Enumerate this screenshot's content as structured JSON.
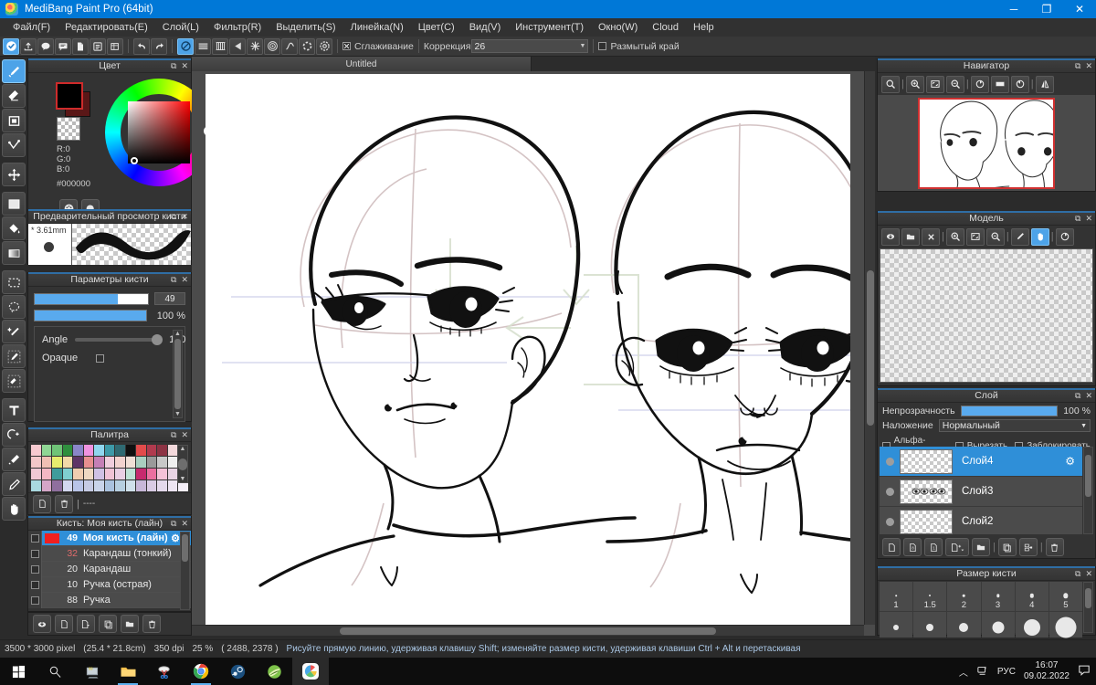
{
  "window": {
    "title": "MediBang Paint Pro (64bit)",
    "minimize": "─",
    "maximize": "❐",
    "close": "✕"
  },
  "menu": {
    "items": [
      {
        "label": "Файл(F)"
      },
      {
        "label": "Редактировать(E)"
      },
      {
        "label": "Слой(L)"
      },
      {
        "label": "Фильтр(R)"
      },
      {
        "label": "Выделить(S)"
      },
      {
        "label": "Линейка(N)"
      },
      {
        "label": "Цвет(C)"
      },
      {
        "label": "Вид(V)"
      },
      {
        "label": "Инструмент(T)"
      },
      {
        "label": "Окно(W)"
      },
      {
        "label": "Cloud"
      },
      {
        "label": "Help"
      }
    ]
  },
  "toolbar": {
    "smoothing_label": "Сглаживание",
    "correction_label": "Коррекция",
    "correction_value": "26",
    "blur_edge_label": "Размытый край",
    "icons": [
      "cloud-check-icon",
      "upload-icon",
      "comment-icon",
      "speech-panel-icon",
      "new-page-icon",
      "page-list-icon",
      "grid-edit-icon",
      "undo-icon",
      "redo-icon",
      "no-ruler-icon",
      "parallel-lines-icon",
      "perspective-grid-icon",
      "vanishing-point-icon",
      "radial-lines-icon",
      "concentric-icon",
      "curve-icon",
      "symmetry-icon",
      "gear-icon"
    ]
  },
  "tools": {
    "items": [
      {
        "name": "brush-tool",
        "selected": true
      },
      {
        "name": "eraser-tool",
        "selected": false
      },
      {
        "name": "shape-tool",
        "selected": false
      },
      {
        "name": "polyline-tool",
        "selected": false
      },
      {
        "name": "move-tool",
        "selected": false
      },
      {
        "name": "fill-rect-tool",
        "selected": false
      },
      {
        "name": "bucket-tool",
        "selected": false
      },
      {
        "name": "gradient-tool",
        "selected": false
      },
      {
        "name": "rect-select-tool",
        "selected": false
      },
      {
        "name": "lasso-tool",
        "selected": false
      },
      {
        "name": "magic-wand-tool",
        "selected": false
      },
      {
        "name": "select-brush-tool",
        "selected": false
      },
      {
        "name": "select-eraser-tool",
        "selected": false
      },
      {
        "name": "text-tool",
        "selected": false
      },
      {
        "name": "divide-tool",
        "selected": false
      },
      {
        "name": "eyedropper-tool",
        "selected": false
      },
      {
        "name": "operation-tool",
        "selected": false
      },
      {
        "name": "hand-tool",
        "selected": false
      }
    ]
  },
  "color_panel": {
    "title": "Цвет",
    "r": "R:0",
    "g": "G:0",
    "b": "B:0",
    "hex": "#000000",
    "foreground": "#000000",
    "background": "#5a1717",
    "buttons": [
      "palette-icon",
      "color-mixer-icon"
    ]
  },
  "brush_preview": {
    "title": "Предварительный просмотр кисти",
    "size": "* 3.61mm"
  },
  "brush_params": {
    "title": "Параметры кисти",
    "size_value": "49",
    "size_percent": 73,
    "opacity_label": "100 %",
    "opacity_percent": 100,
    "angle_label": "Angle",
    "angle_value": "100",
    "opaque_label": "Opaque"
  },
  "palette_panel": {
    "title": "Палитра",
    "note": "----",
    "colors": [
      "#f6c9cf",
      "#8fd694",
      "#6fc477",
      "#2f8f3e",
      "#8a86c8",
      "#f093e0",
      "#8fd7ef",
      "#3d9aa8",
      "#2f6a72",
      "#101010",
      "#e24b4b",
      "#b03a4e",
      "#8d3344",
      "#f3d9dc",
      "#d7a8ad",
      "#f3c7c9",
      "#f0c0b4",
      "#e7ec6e",
      "#f2d9a8",
      "#5e3566",
      "#e78f8f",
      "#c57fb6",
      "#f0cedd",
      "#f2d3cf",
      "#f0dfd6",
      "#a9cfc0",
      "#9a9a9a",
      "#c8c8c8",
      "#efefef",
      "#dcdcdc",
      "#f0c8d4",
      "#f4b8c4",
      "#3f9c9c",
      "#7fcfcf",
      "#f0cdb0",
      "#efd9c2",
      "#cfc1e4",
      "#f0c3d6",
      "#e9cfe4",
      "#bfe2d6",
      "#c62a6e",
      "#eb6fa0",
      "#f4c2d8",
      "#e8d4e4",
      "#efe0ea",
      "#a9d9df",
      "#d5a6c8",
      "#8f6f9e",
      "#d3d7ef",
      "#b9c4e8",
      "#c6cbe4",
      "#c9d4ea",
      "#aac2de",
      "#b7cfe0",
      "#cfe0ea",
      "#c7b7d8",
      "#d9cbe4",
      "#e4d9ec",
      "#ede4f2",
      "#f4eef8"
    ]
  },
  "brush_list": {
    "title": "Кисть: Моя кисть (лайн)",
    "items": [
      {
        "num": "49",
        "name": "Моя кисть (лайн)",
        "selected": true,
        "swatch": "#f02020",
        "num_red": false
      },
      {
        "num": "32",
        "name": "Карандаш (тонкий)",
        "selected": false,
        "swatch": "",
        "num_red": true
      },
      {
        "num": "20",
        "name": "Карандаш",
        "selected": false,
        "swatch": "",
        "num_red": false
      },
      {
        "num": "10",
        "name": "Ручка (острая)",
        "selected": false,
        "swatch": "",
        "num_red": false
      },
      {
        "num": "88",
        "name": "Ручка",
        "selected": false,
        "swatch": "",
        "num_red": false
      }
    ]
  },
  "left_footer": {
    "buttons": [
      "cloud-upload-icon",
      "new-file-icon",
      "add-dropdown-icon",
      "duplicate-icon",
      "folder-icon",
      "trash-icon"
    ]
  },
  "canvas": {
    "tab_label": "Untitled"
  },
  "navigator": {
    "title": "Навигатор",
    "buttons": [
      "zoom-fit-icon",
      "zoom-in-icon",
      "fit-screen-icon",
      "zoom-out-icon",
      "rotate-left-icon",
      "flip-icon",
      "rotate-reset-icon",
      "mirror-icon"
    ]
  },
  "model": {
    "title": "Модель",
    "buttons": [
      "download-model-icon",
      "open-folder-icon",
      "close-icon",
      "zoom-in-icon",
      "fit-icon",
      "zoom-out-icon",
      "pen-icon",
      "hand-icon",
      "rotate-icon"
    ]
  },
  "layers": {
    "title": "Слой",
    "opacity_label": "Непрозрачность",
    "opacity_value": "100 %",
    "blend_label": "Наложение",
    "blend_value": "Нормальный",
    "checkboxes": [
      {
        "label": "Альфа-канал",
        "checked": false
      },
      {
        "label": "Вырезать",
        "checked": false
      },
      {
        "label": "Заблокировать",
        "checked": false
      }
    ],
    "items": [
      {
        "name": "Слой4",
        "selected": true,
        "visible": true
      },
      {
        "name": "Слой3",
        "selected": false,
        "visible": true
      },
      {
        "name": "Слой2",
        "selected": false,
        "visible": true
      }
    ],
    "footer_buttons": [
      "add-layer-icon",
      "add-8bit-layer-icon",
      "add-1bit-layer-icon",
      "add-layer-menu-icon",
      "add-folder-icon",
      "duplicate-layer-icon",
      "merge-layer-icon",
      "delete-layer-icon"
    ]
  },
  "brush_size": {
    "title": "Размер кисти",
    "sizes": [
      "1",
      "1.5",
      "2",
      "3",
      "4",
      "5"
    ]
  },
  "status": {
    "dimensions": "3500 * 3000 pixel",
    "physical": "(25.4 * 21.8cm)",
    "dpi": "350 dpi",
    "zoom": "25 %",
    "cursor": "( 2488, 2378 )",
    "hint": "Рисуйте прямую линию, удерживая клавишу Shift; изменяйте размер кисти, удерживая клавиши Ctrl + Alt и перетаскивая"
  },
  "taskbar": {
    "items": [
      {
        "name": "start-button",
        "icon": "windows-icon",
        "active": false,
        "underline": false
      },
      {
        "name": "search-button",
        "icon": "search-icon",
        "active": false,
        "underline": false
      },
      {
        "name": "task-view-button",
        "icon": "task-view-icon",
        "active": false,
        "underline": false
      },
      {
        "name": "file-explorer",
        "icon": "folder-icon",
        "active": false,
        "underline": true
      },
      {
        "name": "snipping-tool",
        "icon": "scissors-icon",
        "active": false,
        "underline": false
      },
      {
        "name": "chrome",
        "icon": "chrome-icon",
        "active": false,
        "underline": true
      },
      {
        "name": "steam",
        "icon": "steam-icon",
        "active": false,
        "underline": false
      },
      {
        "name": "app-green",
        "icon": "lime-icon",
        "active": false,
        "underline": false
      },
      {
        "name": "medibang",
        "icon": "medibang-icon",
        "active": true,
        "underline": false
      }
    ],
    "lang": "РУС",
    "time": "16:07",
    "date": "09.02.2022",
    "tray_icons": [
      "chevron-up-icon",
      "network-icon",
      "action-center-icon"
    ]
  }
}
